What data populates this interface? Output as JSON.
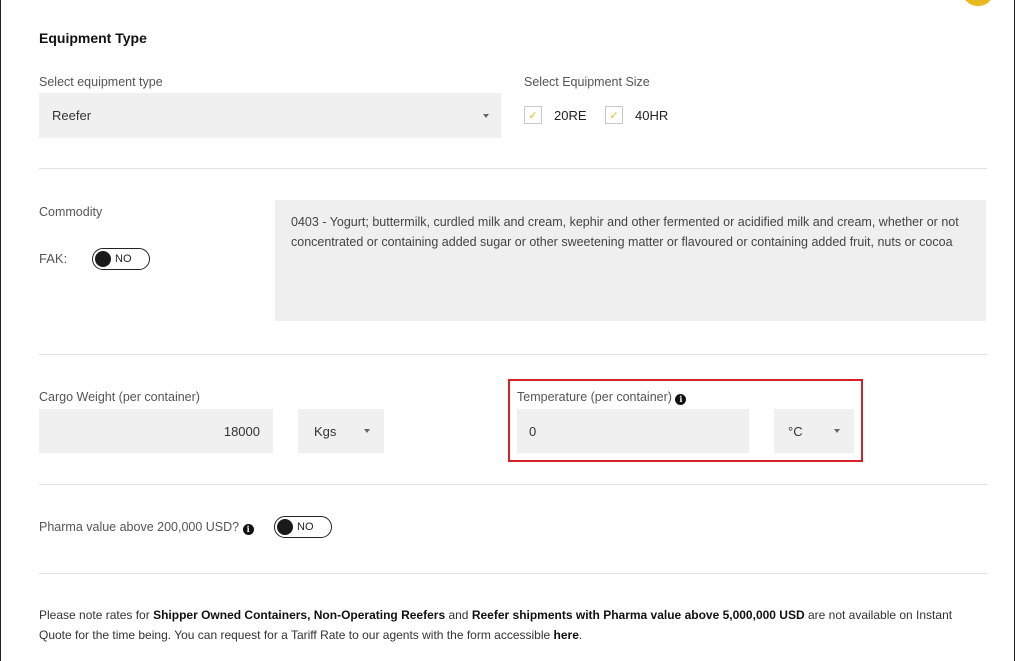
{
  "equipment": {
    "section_title": "Equipment Type",
    "type_label": "Select equipment type",
    "type_value": "Reefer",
    "size_label": "Select Equipment Size",
    "sizes": [
      {
        "label": "20RE",
        "checked": true
      },
      {
        "label": "40HR",
        "checked": true
      }
    ]
  },
  "commodity": {
    "label": "Commodity",
    "fak_label": "FAK:",
    "fak_toggle": "NO",
    "description": "0403 - Yogurt; buttermilk, curdled milk and cream, kephir and other fermented or acidified milk and cream, whether or not concentrated or containing added sugar or other sweetening matter or flavoured or containing added fruit, nuts or cocoa"
  },
  "cargo": {
    "weight_label": "Cargo Weight (per container)",
    "weight_value": "18000",
    "weight_unit": "Kgs",
    "temp_label": "Temperature (per container)",
    "temp_value": "0",
    "temp_unit": "°C"
  },
  "pharma": {
    "label": "Pharma value above 200,000 USD?",
    "toggle": "NO"
  },
  "note": {
    "part1": "Please note rates for ",
    "bold1": "Shipper Owned Containers, Non-Operating Reefers",
    "part2": " and ",
    "bold2": "Reefer shipments with Pharma value above 5,000,000 USD",
    "part3": " are not available on Instant Quote for the time being. You can request for a Tariff Rate to our agents with the form accessible ",
    "link": "here",
    "part4": "."
  },
  "colors": {
    "accent": "#e9b820",
    "highlight": "#d8202a",
    "field_bg": "#f0f0f0"
  },
  "icons": [
    "chevron-down-icon",
    "check-icon",
    "info-icon"
  ]
}
